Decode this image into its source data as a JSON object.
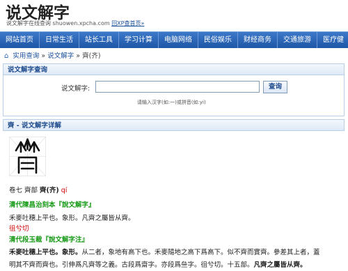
{
  "header": {
    "title": "说文解字",
    "tagline_prefix": "说文解字在线查询",
    "tagline_url": "shuowen.xpcha.com",
    "back_link": "回XP查首页»"
  },
  "nav": [
    "网站首页",
    "日常生活",
    "站长工具",
    "学习计算",
    "电脑网络",
    "民俗娱乐",
    "财经商务",
    "交通旅游",
    "医疗健"
  ],
  "breadcrumb": {
    "home_icon": "home-icon",
    "root": "实用查询",
    "sep1": " » ",
    "section": "说文解字",
    "sep2": " » ",
    "current": "齊(齐)"
  },
  "search": {
    "panel_title": "说文解字查询",
    "label": "说文解字:",
    "value": "",
    "button": "查询",
    "hint": "请输入汉字(如:一)或拼音(如:yi)"
  },
  "detail": {
    "panel_title": "齊 - 说文解字详解",
    "vol": "卷七 齊部 ",
    "char": "齊(齐)",
    "pinyin": " qí",
    "sec1_title": "清代陳昌治刻本『說文解字』",
    "sec1_text": "禾麥吐穗上平也。象形。凡齊之屬皆从齊。",
    "fanqie": "徂兮切",
    "sec2_title": "清代段玉裁『說文解字注』",
    "sec2_line1_bold": "禾麥吐穗上平也。象形。",
    "sec2_line1_rest": "从二者，象地有高下也。禾麥隨地之高下爲高下。似不齊而實齊。參差其上者，蓋",
    "sec2_line2_rest": "明其不齊而齊也。引伸爲凡齊等之義。古段爲齋字。亦段爲亝字。徂兮切。十五部。",
    "sec2_line2_bold": "凡齊之屬皆从齊。"
  }
}
